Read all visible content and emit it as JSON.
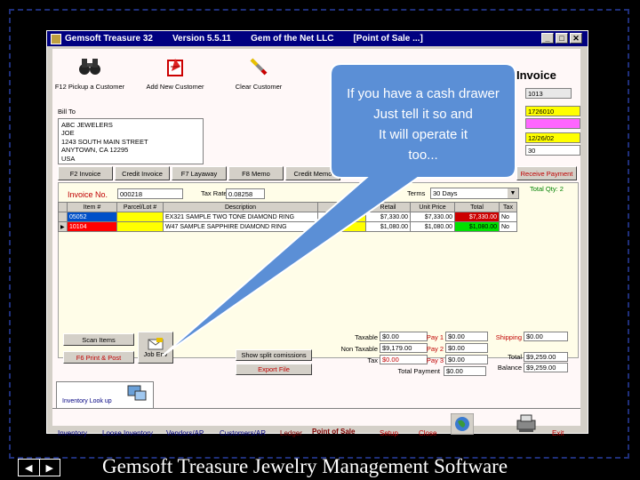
{
  "window": {
    "title_parts": [
      "Gemsoft Treasure 32",
      "Version 5.5.11",
      "Gem of the Net LLC",
      "[Point of Sale ...]"
    ]
  },
  "toolbar": {
    "items": [
      {
        "label": "F12 Pickup a Customer",
        "icon": "binoculars-icon"
      },
      {
        "label": "Add New Customer",
        "icon": "add-customer-icon"
      },
      {
        "label": "Clear Customer",
        "icon": "clear-customer-icon"
      }
    ],
    "invoice_heading": "Invoice"
  },
  "bill_to": {
    "label": "Bill To",
    "lines": "ABC JEWELERS\nJOE\n1243 SOUTH MAIN STREET\nANYTOWN, CA 12295\nUSA"
  },
  "right_fields": [
    "1013",
    "1726010",
    "",
    "12/26/02",
    "30"
  ],
  "tabs": [
    "F2 Invoice",
    "Credit Invoice",
    "F7 Layaway",
    "F8 Memo",
    "Credit Memo"
  ],
  "receive_payment_label": "Receive Payment",
  "total_qty_label": "Total Qty: 2",
  "invoice_no": {
    "label": "Invoice No.",
    "value": "000218"
  },
  "tax_rate": {
    "label": "Tax Rate",
    "value": "0.08258"
  },
  "terms": {
    "label": "Terms",
    "value": "30 Days"
  },
  "grid": {
    "headers": [
      "Item #",
      "Parcel/Lot #",
      "Description",
      "",
      "",
      "Retail",
      "Unit Price",
      "Total",
      "Tax"
    ],
    "rows": [
      [
        "05052",
        "",
        "EX321 SAMPLE TWO TONE DIAMOND RING",
        "",
        "",
        "$7,330.00",
        "$7,330.00",
        "$7,330.00",
        "No"
      ],
      [
        "10104",
        "",
        "W47 SAMPLE SAPPHIRE DIAMOND RING",
        "",
        "",
        "$1,080.00",
        "$1,080.00",
        "$1,080.00",
        "No"
      ]
    ]
  },
  "buttons": {
    "scan_items": "Scan Items",
    "print_post": "F6 Print & Post",
    "job_env": "Job Env",
    "show_split": "Show split comissions",
    "export_file": "Export File"
  },
  "totals": {
    "taxable": {
      "label": "Taxable",
      "value": "$0.00"
    },
    "non_taxable": {
      "label": "Non Taxable",
      "value": "$9,179.00"
    },
    "tax": {
      "label": "Tax",
      "value": "$0.00"
    },
    "total_payment": {
      "label": "Total Payment",
      "value": "$0.00"
    },
    "pay1": {
      "label": "Pay 1",
      "value": "$0.00"
    },
    "pay2": {
      "label": "Pay 2",
      "value": "$0.00"
    },
    "pay3": {
      "label": "Pay 3",
      "value": "$0.00"
    },
    "shipping": {
      "label": "Shipping",
      "value": "$0.00"
    },
    "total": {
      "label": "Total",
      "value": "$9,259.00"
    },
    "balance": {
      "label": "Balance",
      "value": "$9,259.00"
    }
  },
  "inventory_lookup_tab": "Inventory Look up",
  "bottom_nav": [
    "Inventory",
    "Loose Inventory",
    "Vendors/AP",
    "Customers/AR",
    "Ledger",
    "Point of Sale",
    "Setup",
    "Close",
    "Exit"
  ],
  "callout": {
    "lines": [
      "If you have a cash drawer",
      "Just  tell it so and",
      "It will operate it",
      "too..."
    ]
  },
  "footer": {
    "caption": "Gemsoft Treasure  Jewelry Management Software"
  },
  "colors": {
    "title_bar": "#000080",
    "callout_fill": "#5b8fd6",
    "highlight_yellow": "#ffff00",
    "highlight_magenta": "#ff66ff",
    "highlight_green": "#00e000",
    "highlight_red": "#ff0000",
    "accent_red": "#cc0000"
  }
}
